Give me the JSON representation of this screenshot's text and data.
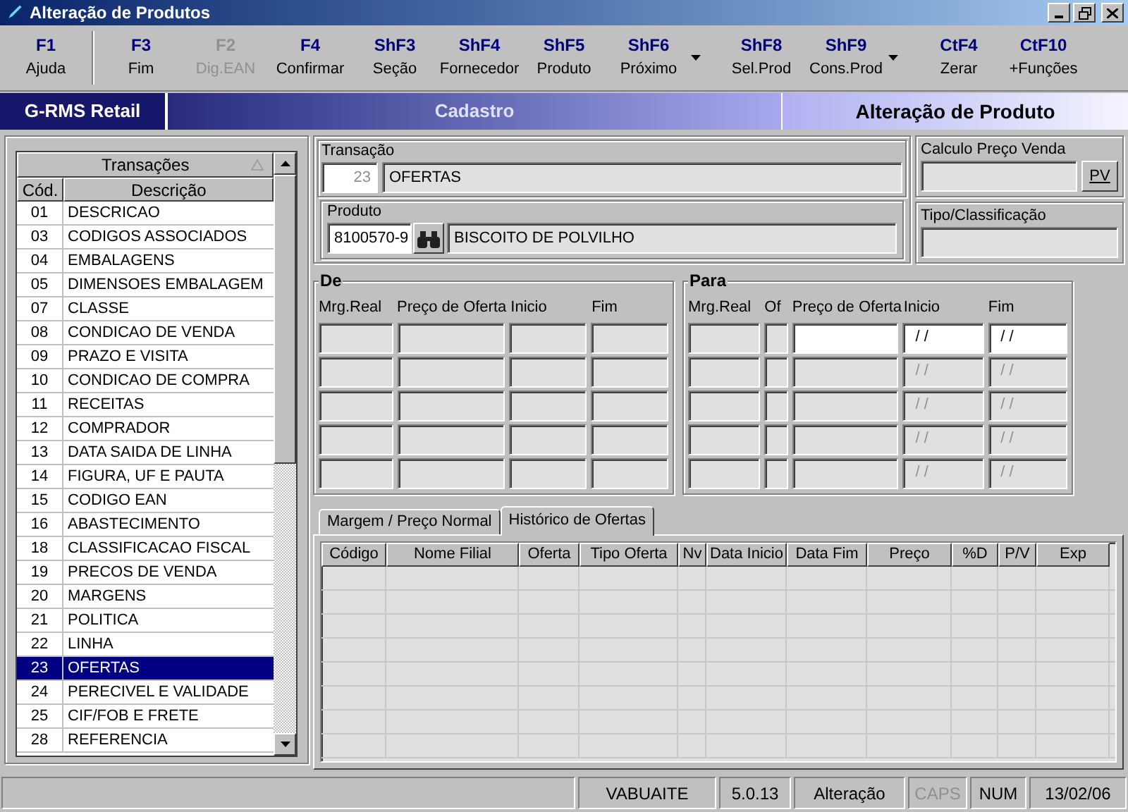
{
  "window": {
    "title": "Alteração de Produtos"
  },
  "toolbar": [
    {
      "key": "F1",
      "label": "Ajuda",
      "disabled": false,
      "dropdown": false,
      "separator_after": true
    },
    {
      "key": "F3",
      "label": "Fim",
      "disabled": false,
      "dropdown": false,
      "separator_after": false
    },
    {
      "key": "F2",
      "label": "Dig.EAN",
      "disabled": true,
      "dropdown": false,
      "separator_after": false
    },
    {
      "key": "F4",
      "label": "Confirmar",
      "disabled": false,
      "dropdown": false,
      "separator_after": false
    },
    {
      "key": "ShF3",
      "label": "Seção",
      "disabled": false,
      "dropdown": false,
      "separator_after": false
    },
    {
      "key": "ShF4",
      "label": "Fornecedor",
      "disabled": false,
      "dropdown": false,
      "separator_after": false
    },
    {
      "key": "ShF5",
      "label": "Produto",
      "disabled": false,
      "dropdown": false,
      "separator_after": false
    },
    {
      "key": "ShF6",
      "label": "Próximo",
      "disabled": false,
      "dropdown": true,
      "separator_after": false
    },
    {
      "key": "ShF8",
      "label": "Sel.Prod",
      "disabled": false,
      "dropdown": false,
      "separator_after": false
    },
    {
      "key": "ShF9",
      "label": "Cons.Prod",
      "disabled": false,
      "dropdown": true,
      "separator_after": false
    },
    {
      "key": "CtF4",
      "label": "Zerar",
      "disabled": false,
      "dropdown": false,
      "separator_after": false
    },
    {
      "key": "CtF10",
      "label": "+Funções",
      "disabled": false,
      "dropdown": false,
      "separator_after": false
    }
  ],
  "header": {
    "app": "G-RMS Retail",
    "module": "Cadastro",
    "screen": "Alteração de Produto"
  },
  "transactions": {
    "title": "Transações",
    "columns": [
      "Cód.",
      "Descrição"
    ],
    "rows": [
      {
        "code": "01",
        "description": "DESCRICAO",
        "selected": false
      },
      {
        "code": "03",
        "description": "CODIGOS ASSOCIADOS",
        "selected": false
      },
      {
        "code": "04",
        "description": "EMBALAGENS",
        "selected": false
      },
      {
        "code": "05",
        "description": "DIMENSOES EMBALAGEM",
        "selected": false
      },
      {
        "code": "07",
        "description": "CLASSE",
        "selected": false
      },
      {
        "code": "08",
        "description": "CONDICAO DE VENDA",
        "selected": false
      },
      {
        "code": "09",
        "description": "PRAZO E VISITA",
        "selected": false
      },
      {
        "code": "10",
        "description": "CONDICAO DE COMPRA",
        "selected": false
      },
      {
        "code": "11",
        "description": "RECEITAS",
        "selected": false
      },
      {
        "code": "12",
        "description": "COMPRADOR",
        "selected": false
      },
      {
        "code": "13",
        "description": "DATA SAIDA DE LINHA",
        "selected": false
      },
      {
        "code": "14",
        "description": "FIGURA, UF E PAUTA",
        "selected": false
      },
      {
        "code": "15",
        "description": "CODIGO EAN",
        "selected": false
      },
      {
        "code": "16",
        "description": "ABASTECIMENTO",
        "selected": false
      },
      {
        "code": "18",
        "description": "CLASSIFICACAO FISCAL",
        "selected": false
      },
      {
        "code": "19",
        "description": "PRECOS DE VENDA",
        "selected": false
      },
      {
        "code": "20",
        "description": "MARGENS",
        "selected": false
      },
      {
        "code": "21",
        "description": "POLITICA",
        "selected": false
      },
      {
        "code": "22",
        "description": "LINHA",
        "selected": false
      },
      {
        "code": "23",
        "description": "OFERTAS",
        "selected": true
      },
      {
        "code": "24",
        "description": "PERECIVEL E VALIDADE",
        "selected": false
      },
      {
        "code": "25",
        "description": "CIF/FOB E FRETE",
        "selected": false
      },
      {
        "code": "28",
        "description": "REFERENCIA",
        "selected": false
      }
    ]
  },
  "transacao": {
    "label": "Transação",
    "code": "23",
    "name": "OFERTAS"
  },
  "produto": {
    "label": "Produto",
    "code": "8100570-9",
    "name": "BISCOITO DE POLVILHO"
  },
  "calculo": {
    "label": "Calculo Preço Venda",
    "button": "PV"
  },
  "tipo": {
    "label": "Tipo/Classificação"
  },
  "de": {
    "title": "De",
    "columns": [
      "Mrg.Real",
      "Preço de Oferta",
      "Inicio",
      "Fim"
    ]
  },
  "para": {
    "title": "Para",
    "columns": [
      "Mrg.Real",
      "Of",
      "Preço de Oferta",
      "Inicio",
      "Fim"
    ],
    "rows": [
      {
        "inicio": "/ /",
        "fim": "/ /",
        "disabled": false
      },
      {
        "inicio": "/ /",
        "fim": "/ /",
        "disabled": true
      },
      {
        "inicio": "/ /",
        "fim": "/ /",
        "disabled": true
      },
      {
        "inicio": "/ /",
        "fim": "/ /",
        "disabled": true
      },
      {
        "inicio": "/ /",
        "fim": "/ /",
        "disabled": true
      }
    ]
  },
  "tabs": [
    {
      "label": "Margem / Preço Normal",
      "selected": false
    },
    {
      "label": "Histórico de Ofertas",
      "selected": true
    }
  ],
  "history": {
    "columns": [
      "Código",
      "Nome Filial",
      "Oferta",
      "Tipo Oferta",
      "Nv",
      "Data Inicio",
      "Data Fim",
      "Preço",
      "%D",
      "P/V",
      "Exp"
    ]
  },
  "status_bar": [
    {
      "text": "VABUAITE",
      "disabled": false
    },
    {
      "text": "5.0.13",
      "disabled": false
    },
    {
      "text": "Alteração",
      "disabled": false
    },
    {
      "text": "CAPS",
      "disabled": true
    },
    {
      "text": "NUM",
      "disabled": false
    },
    {
      "text": "13/02/06",
      "disabled": false
    }
  ]
}
